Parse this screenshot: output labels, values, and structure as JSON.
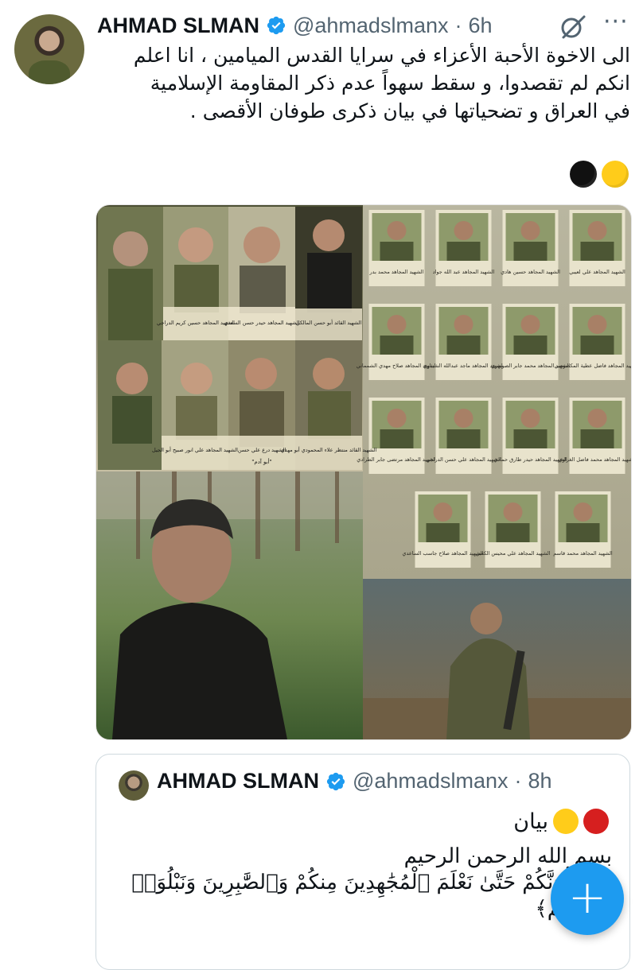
{
  "tweet": {
    "author_name": "AHMAD SLMAN",
    "handle": "@ahmadslmanx",
    "separator": "·",
    "time": "6h",
    "text_lines": [
      "الى الاخوة الأحبة الأعزاء في سرايا القدس الميامين ، انا اعلم",
      "انكم لم تقصدوا،  و سقط سهواً عدم ذكر المقاومة الإسلامية",
      "في العراق و تضحياتها في بيان ذكرى طوفان الأقصى ."
    ],
    "emoji_colors": [
      "#111111",
      "#ffcc1a"
    ],
    "icons": {
      "verified": "verified-badge-icon",
      "grok": "grok-icon",
      "more": "more-icon"
    },
    "more_label": "···"
  },
  "media": {
    "poster_captions": [
      "الشهيد المجاهد حسين كريم الدراجي",
      "الشهيد المجاهد حيدر حسن السعدي",
      "الشهيد القائد أبو حسن المالكي",
      "الشهيد المجاهد علي انور صبيح أبو الجيل",
      "الشهيد درع علي حسن",
      "الشهيد القائد منتظر علاء المحمودي أبو مهدي",
      "\"أبو آدم\""
    ],
    "grid_captions": [
      "الشهيد المجاهد محمد بدر",
      "الشهيد المجاهد عبد الله جواد",
      "الشهيد المجاهد حسين هادي",
      "الشهيد المجاهد علي لعيبي",
      "الشهيد المجاهد صلاح مهدي الشمماني",
      "الشهيد المجاهد ماجد عبدالله الشيباوي",
      "الشهيد المجاهد محمد جابر الصويهري",
      "الشهيد المجاهد فاضل عطية المكصوصي",
      "الشهيد المجاهد مرتضى جابر الطرادي",
      "الشهيد المجاهد علي حسن الدراجي",
      "الشهيد المجاهد حيدر طارق حمادي",
      "الشهيد المجاهد محمد فاضل الغراوي",
      "الشهيد المجاهد صلاح جاسب الساعدي",
      "الشهيد المجاهد علي محيس الكعبي",
      "الشهيد المجاهد محمد قاسم"
    ]
  },
  "quote": {
    "author_name": "AHMAD SLMAN",
    "handle": "@ahmadslmanx",
    "separator": "·",
    "time": "8h",
    "first_line": "بيان",
    "emoji_colors": [
      "#ffcc1a",
      "#d61f1f"
    ],
    "lines": [
      "بسم الله الرحمن الرحيم",
      "﴿وَلَنَبْلُوَنَّكُمْ حَتَّىٰ نَعْلَمَ ٱلْمُجَٰهِدِينَ مِنكُمْ وَٱلصَّٰبِرِينَ وَنَبْلُوَا۟",
      "أَخْبَارَكُمْ﴾"
    ]
  },
  "fab": {
    "label": "+",
    "color": "#1d9bf0"
  }
}
